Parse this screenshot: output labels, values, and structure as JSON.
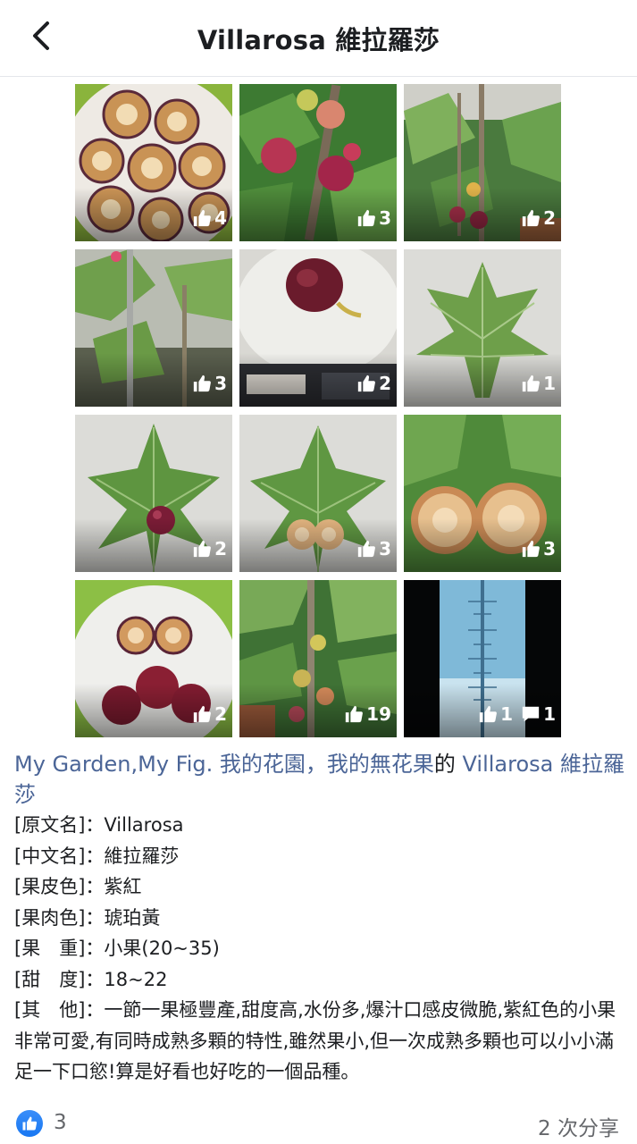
{
  "header": {
    "title": "Villarosa 維拉羅莎",
    "back_icon": "chevron-left-icon"
  },
  "photos": [
    {
      "likes": "4",
      "subject": "sliced-figs-on-plate"
    },
    {
      "likes": "3",
      "subject": "figs-on-branch"
    },
    {
      "likes": "2",
      "subject": "fig-tree-pots"
    },
    {
      "likes": "3",
      "subject": "young-fig-tree"
    },
    {
      "likes": "2",
      "subject": "fig-on-scale"
    },
    {
      "likes": "1",
      "subject": "fig-leaf"
    },
    {
      "likes": "2",
      "subject": "fig-on-leaf"
    },
    {
      "likes": "3",
      "subject": "fig-halves-on-leaf"
    },
    {
      "likes": "3",
      "subject": "fig-halves-closeup"
    },
    {
      "likes": "2",
      "subject": "figs-on-green-plate"
    },
    {
      "likes": "19",
      "subject": "fig-tree-with-fruit"
    },
    {
      "likes": "1",
      "comments": "1",
      "subject": "refractometer-reading"
    }
  ],
  "caption": {
    "part1": "My Garden,My Fig. 我的花園，我的無花果",
    "part2": "的 ",
    "part3": "Villarosa 維拉羅莎"
  },
  "details": [
    {
      "label": "[原文名]：",
      "value": "Villarosa"
    },
    {
      "label": "[中文名]：",
      "value": "維拉羅莎"
    },
    {
      "label": "[果皮色]：",
      "value": "紫紅"
    },
    {
      "label": "[果肉色]：",
      "value": "琥珀黃"
    },
    {
      "label": "[果　重]：",
      "value": "小果(20~35)"
    },
    {
      "label": "[甜　度]：",
      "value": "18~22"
    }
  ],
  "other": {
    "label": "[其　他]：",
    "value": "一節一果極豐產,甜度高,水份多,爆汁口感皮微脆,紫紅色的小果非常可愛,有同時成熟多顆的特性,雖然果小,但一次成熟多顆也可以小小滿足一下口慾!算是好看也好吃的一個品種。"
  },
  "footer": {
    "like_count": "3",
    "shares": "2 次分享"
  },
  "colors": {
    "link": "#4b6597",
    "like_blue": "#1877f2",
    "muted": "#65676b"
  }
}
